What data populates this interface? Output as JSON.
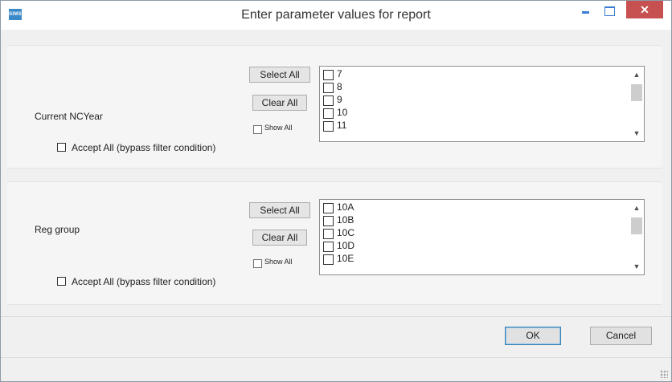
{
  "window": {
    "title": "Enter parameter values for report",
    "app_icon_text": "SIMS",
    "close_glyph": "✕"
  },
  "parameters": [
    {
      "label": "Current NCYear",
      "select_all": "Select All",
      "clear_all": "Clear All",
      "show_all": "Show All",
      "accept_all": "Accept All (bypass filter condition)",
      "items": [
        "7",
        "8",
        "9",
        "10",
        "11"
      ],
      "accept_all_checked": false,
      "show_all_checked": false
    },
    {
      "label": "Reg group",
      "select_all": "Select All",
      "clear_all": "Clear All",
      "show_all": "Show All",
      "accept_all": "Accept All (bypass filter condition)",
      "items": [
        "10A",
        "10B",
        "10C",
        "10D",
        "10E"
      ],
      "accept_all_checked": false,
      "show_all_checked": false
    }
  ],
  "footer": {
    "ok": "OK",
    "cancel": "Cancel"
  },
  "colors": {
    "close_button": "#c75050",
    "window_controls": "#3a7dd2",
    "ok_border": "#3c7fb1"
  },
  "icons": {
    "scroll_up": "▲",
    "scroll_down": "▼"
  }
}
